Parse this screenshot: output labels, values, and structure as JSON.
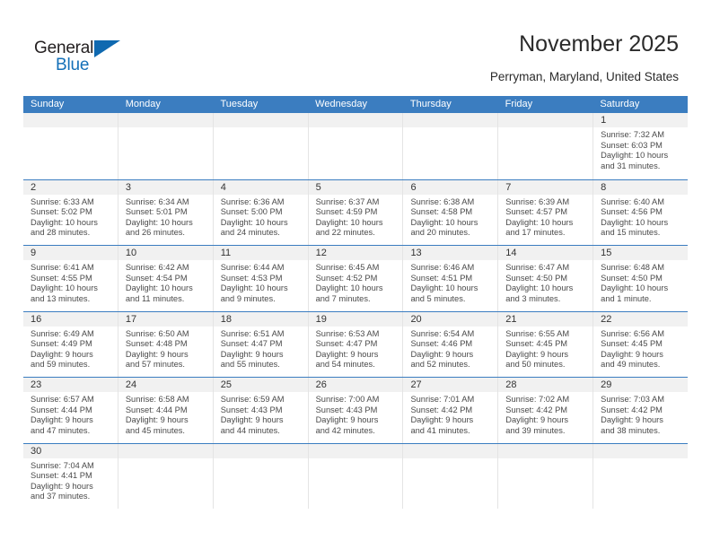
{
  "brand": {
    "name_part1": "General",
    "name_part2": "Blue",
    "triangle_color": "#0f69b0",
    "blue_color": "#1470b8"
  },
  "header": {
    "title": "November 2025",
    "subtitle": "Perryman, Maryland, United States"
  },
  "calendar": {
    "header_color": "#3b7dc0",
    "weekdays": [
      "Sunday",
      "Monday",
      "Tuesday",
      "Wednesday",
      "Thursday",
      "Friday",
      "Saturday"
    ],
    "labels": {
      "sunrise": "Sunrise:",
      "sunset": "Sunset:",
      "daylight": "Daylight:"
    },
    "weeks": [
      [
        {
          "empty": true
        },
        {
          "empty": true
        },
        {
          "empty": true
        },
        {
          "empty": true
        },
        {
          "empty": true
        },
        {
          "empty": true
        },
        {
          "day": "1",
          "sunrise": "Sunrise: 7:32 AM",
          "sunset": "Sunset: 6:03 PM",
          "daylight_line1": "Daylight: 10 hours",
          "daylight_line2": "and 31 minutes."
        }
      ],
      [
        {
          "day": "2",
          "sunrise": "Sunrise: 6:33 AM",
          "sunset": "Sunset: 5:02 PM",
          "daylight_line1": "Daylight: 10 hours",
          "daylight_line2": "and 28 minutes."
        },
        {
          "day": "3",
          "sunrise": "Sunrise: 6:34 AM",
          "sunset": "Sunset: 5:01 PM",
          "daylight_line1": "Daylight: 10 hours",
          "daylight_line2": "and 26 minutes."
        },
        {
          "day": "4",
          "sunrise": "Sunrise: 6:36 AM",
          "sunset": "Sunset: 5:00 PM",
          "daylight_line1": "Daylight: 10 hours",
          "daylight_line2": "and 24 minutes."
        },
        {
          "day": "5",
          "sunrise": "Sunrise: 6:37 AM",
          "sunset": "Sunset: 4:59 PM",
          "daylight_line1": "Daylight: 10 hours",
          "daylight_line2": "and 22 minutes."
        },
        {
          "day": "6",
          "sunrise": "Sunrise: 6:38 AM",
          "sunset": "Sunset: 4:58 PM",
          "daylight_line1": "Daylight: 10 hours",
          "daylight_line2": "and 20 minutes."
        },
        {
          "day": "7",
          "sunrise": "Sunrise: 6:39 AM",
          "sunset": "Sunset: 4:57 PM",
          "daylight_line1": "Daylight: 10 hours",
          "daylight_line2": "and 17 minutes."
        },
        {
          "day": "8",
          "sunrise": "Sunrise: 6:40 AM",
          "sunset": "Sunset: 4:56 PM",
          "daylight_line1": "Daylight: 10 hours",
          "daylight_line2": "and 15 minutes."
        }
      ],
      [
        {
          "day": "9",
          "sunrise": "Sunrise: 6:41 AM",
          "sunset": "Sunset: 4:55 PM",
          "daylight_line1": "Daylight: 10 hours",
          "daylight_line2": "and 13 minutes."
        },
        {
          "day": "10",
          "sunrise": "Sunrise: 6:42 AM",
          "sunset": "Sunset: 4:54 PM",
          "daylight_line1": "Daylight: 10 hours",
          "daylight_line2": "and 11 minutes."
        },
        {
          "day": "11",
          "sunrise": "Sunrise: 6:44 AM",
          "sunset": "Sunset: 4:53 PM",
          "daylight_line1": "Daylight: 10 hours",
          "daylight_line2": "and 9 minutes."
        },
        {
          "day": "12",
          "sunrise": "Sunrise: 6:45 AM",
          "sunset": "Sunset: 4:52 PM",
          "daylight_line1": "Daylight: 10 hours",
          "daylight_line2": "and 7 minutes."
        },
        {
          "day": "13",
          "sunrise": "Sunrise: 6:46 AM",
          "sunset": "Sunset: 4:51 PM",
          "daylight_line1": "Daylight: 10 hours",
          "daylight_line2": "and 5 minutes."
        },
        {
          "day": "14",
          "sunrise": "Sunrise: 6:47 AM",
          "sunset": "Sunset: 4:50 PM",
          "daylight_line1": "Daylight: 10 hours",
          "daylight_line2": "and 3 minutes."
        },
        {
          "day": "15",
          "sunrise": "Sunrise: 6:48 AM",
          "sunset": "Sunset: 4:50 PM",
          "daylight_line1": "Daylight: 10 hours",
          "daylight_line2": "and 1 minute."
        }
      ],
      [
        {
          "day": "16",
          "sunrise": "Sunrise: 6:49 AM",
          "sunset": "Sunset: 4:49 PM",
          "daylight_line1": "Daylight: 9 hours",
          "daylight_line2": "and 59 minutes."
        },
        {
          "day": "17",
          "sunrise": "Sunrise: 6:50 AM",
          "sunset": "Sunset: 4:48 PM",
          "daylight_line1": "Daylight: 9 hours",
          "daylight_line2": "and 57 minutes."
        },
        {
          "day": "18",
          "sunrise": "Sunrise: 6:51 AM",
          "sunset": "Sunset: 4:47 PM",
          "daylight_line1": "Daylight: 9 hours",
          "daylight_line2": "and 55 minutes."
        },
        {
          "day": "19",
          "sunrise": "Sunrise: 6:53 AM",
          "sunset": "Sunset: 4:47 PM",
          "daylight_line1": "Daylight: 9 hours",
          "daylight_line2": "and 54 minutes."
        },
        {
          "day": "20",
          "sunrise": "Sunrise: 6:54 AM",
          "sunset": "Sunset: 4:46 PM",
          "daylight_line1": "Daylight: 9 hours",
          "daylight_line2": "and 52 minutes."
        },
        {
          "day": "21",
          "sunrise": "Sunrise: 6:55 AM",
          "sunset": "Sunset: 4:45 PM",
          "daylight_line1": "Daylight: 9 hours",
          "daylight_line2": "and 50 minutes."
        },
        {
          "day": "22",
          "sunrise": "Sunrise: 6:56 AM",
          "sunset": "Sunset: 4:45 PM",
          "daylight_line1": "Daylight: 9 hours",
          "daylight_line2": "and 49 minutes."
        }
      ],
      [
        {
          "day": "23",
          "sunrise": "Sunrise: 6:57 AM",
          "sunset": "Sunset: 4:44 PM",
          "daylight_line1": "Daylight: 9 hours",
          "daylight_line2": "and 47 minutes."
        },
        {
          "day": "24",
          "sunrise": "Sunrise: 6:58 AM",
          "sunset": "Sunset: 4:44 PM",
          "daylight_line1": "Daylight: 9 hours",
          "daylight_line2": "and 45 minutes."
        },
        {
          "day": "25",
          "sunrise": "Sunrise: 6:59 AM",
          "sunset": "Sunset: 4:43 PM",
          "daylight_line1": "Daylight: 9 hours",
          "daylight_line2": "and 44 minutes."
        },
        {
          "day": "26",
          "sunrise": "Sunrise: 7:00 AM",
          "sunset": "Sunset: 4:43 PM",
          "daylight_line1": "Daylight: 9 hours",
          "daylight_line2": "and 42 minutes."
        },
        {
          "day": "27",
          "sunrise": "Sunrise: 7:01 AM",
          "sunset": "Sunset: 4:42 PM",
          "daylight_line1": "Daylight: 9 hours",
          "daylight_line2": "and 41 minutes."
        },
        {
          "day": "28",
          "sunrise": "Sunrise: 7:02 AM",
          "sunset": "Sunset: 4:42 PM",
          "daylight_line1": "Daylight: 9 hours",
          "daylight_line2": "and 39 minutes."
        },
        {
          "day": "29",
          "sunrise": "Sunrise: 7:03 AM",
          "sunset": "Sunset: 4:42 PM",
          "daylight_line1": "Daylight: 9 hours",
          "daylight_line2": "and 38 minutes."
        }
      ],
      [
        {
          "day": "30",
          "sunrise": "Sunrise: 7:04 AM",
          "sunset": "Sunset: 4:41 PM",
          "daylight_line1": "Daylight: 9 hours",
          "daylight_line2": "and 37 minutes."
        },
        {
          "empty": true
        },
        {
          "empty": true
        },
        {
          "empty": true
        },
        {
          "empty": true
        },
        {
          "empty": true
        },
        {
          "empty": true
        }
      ]
    ]
  }
}
